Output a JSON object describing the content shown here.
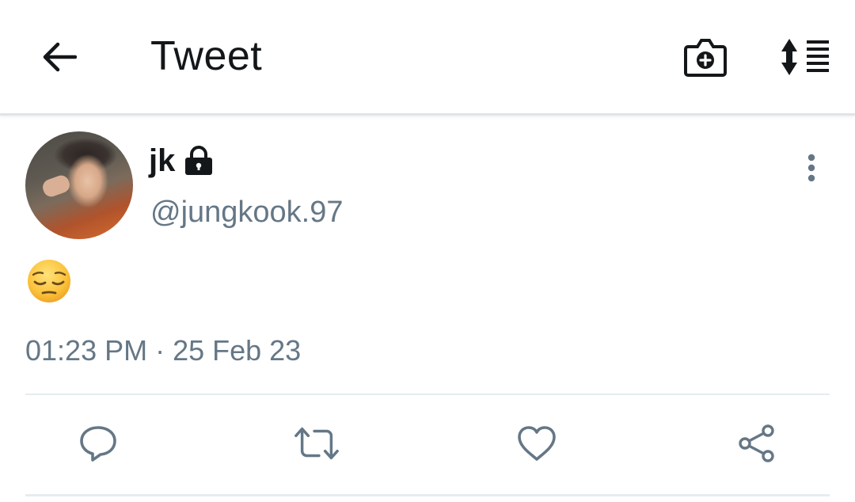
{
  "header": {
    "title": "Tweet",
    "back_icon": "arrow-left-icon",
    "camera_icon": "camera-plus-icon",
    "sort_icon": "sort-list-icon"
  },
  "tweet": {
    "author": {
      "display_name": "jk",
      "handle": "@jungkook.97",
      "protected_icon": "lock-icon"
    },
    "text": "😔",
    "timestamp": "01:23 PM · 25 Feb 23"
  },
  "actions": {
    "icons": [
      "reply-icon",
      "retweet-icon",
      "like-icon",
      "share-icon"
    ]
  },
  "colors": {
    "primary_text": "#14171a",
    "secondary_text": "#657786",
    "divider": "#e6ecf0",
    "action_icon": "#657786"
  }
}
